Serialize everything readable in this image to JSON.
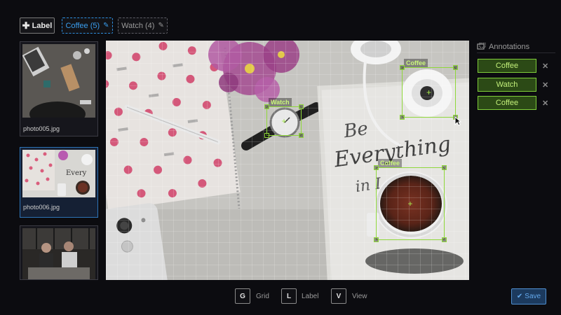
{
  "toolbar": {
    "add_label": "Label",
    "tags": [
      {
        "label": "Coffee (5)",
        "active": true
      },
      {
        "label": "Watch (4)",
        "active": false
      }
    ]
  },
  "thumbnails": [
    {
      "name": "photo005.jpg",
      "selected": false
    },
    {
      "name": "photo006.jpg",
      "selected": true
    },
    {
      "name": "",
      "selected": false
    }
  ],
  "canvas": {
    "boxes": [
      {
        "label": "Watch"
      },
      {
        "label": "Coffee"
      },
      {
        "label": "Coffee"
      }
    ]
  },
  "annotations": {
    "title": "Annotations",
    "items": [
      "Coffee",
      "Watch",
      "Coffee"
    ]
  },
  "hotkeys": [
    {
      "key": "G",
      "label": "Grid"
    },
    {
      "key": "L",
      "label": "Label"
    },
    {
      "key": "V",
      "label": "View"
    }
  ],
  "save_label": "Save",
  "colors": {
    "accent_blue": "#2e8fe0",
    "box_green": "#8fd83a",
    "annotation_bg": "#2c4a16"
  },
  "icons": {
    "add": "plus-icon",
    "edit": "pencil-icon",
    "annotations": "annotations-icon",
    "remove": "close-icon",
    "save": "check-icon",
    "box_center": "crosshair-icon"
  }
}
